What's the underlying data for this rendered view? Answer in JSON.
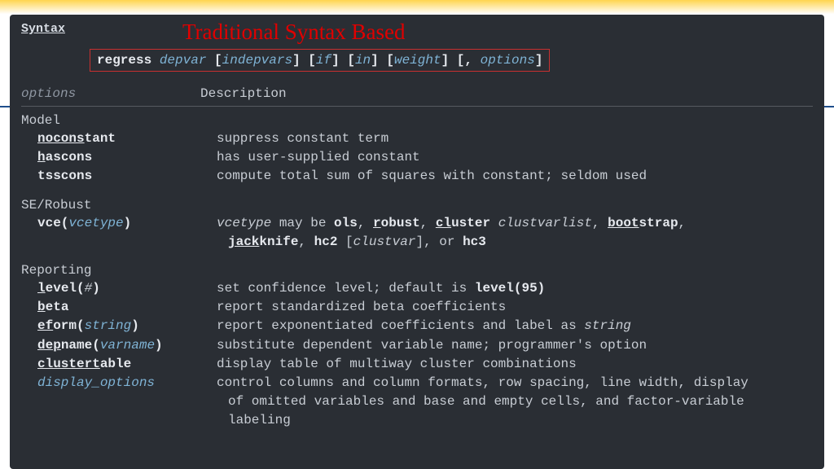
{
  "header": {
    "syntax_link": "Syntax",
    "red_title": "Traditional Syntax Based",
    "cmd": {
      "regress": "regress",
      "depvar": "depvar",
      "indepvars": "indepvars",
      "if": "if",
      "in": "in",
      "weight": "weight",
      "options": "options"
    },
    "options_hdr": "options",
    "description_hdr": "Description"
  },
  "sections": {
    "model": {
      "title": "Model",
      "noconstant": {
        "u": "nocons",
        "rest": "tant",
        "desc": "suppress constant term"
      },
      "hascons": {
        "u": "h",
        "rest": "ascons",
        "desc": "has user-supplied constant"
      },
      "tsscons": {
        "label": "tsscons",
        "desc": "compute total sum of squares with constant; seldom used"
      }
    },
    "se": {
      "title": "SE/Robust",
      "vce": {
        "label_pre": "vce(",
        "arg": "vcetype",
        "label_post": ")"
      },
      "vce_desc": {
        "vcetype": "vcetype",
        "p1": " may be ",
        "ols": "ols",
        "robust_u": "r",
        "robust_rest": "obust",
        "cluster_u": "cl",
        "cluster_rest": "uster",
        "clustvarlist": "clustvarlist",
        "boot_u": "boot",
        "boot_rest": "strap",
        "jack_u": "jack",
        "jack_rest": "knife",
        "hc2": "hc2",
        "clustvar": "clustvar",
        "or": ", or ",
        "hc3": "hc3"
      }
    },
    "reporting": {
      "title": "Reporting",
      "level": {
        "u": "l",
        "rest": "evel(",
        "arg": "#",
        "post": ")",
        "desc_pre": "set confidence level; default is ",
        "desc_bold": "level(95)"
      },
      "beta": {
        "u": "b",
        "rest": "eta",
        "desc": "report standardized beta coefficients"
      },
      "eform": {
        "u": "ef",
        "rest": "orm(",
        "arg": "string",
        "post": ")",
        "desc_pre": "report exponentiated coefficients and label as ",
        "desc_it": "string"
      },
      "depname": {
        "u": "dep",
        "rest": "name(",
        "arg": "varname",
        "post": ")",
        "desc": "substitute dependent variable name; programmer's option"
      },
      "clustert": {
        "u": "clustert",
        "rest": "able",
        "desc": "display table of multiway cluster combinations"
      },
      "display": {
        "label": "display_options",
        "l1": "control columns and column formats, row spacing, line width, display",
        "l2": "of omitted variables and base and empty cells, and factor-variable",
        "l3": "labeling"
      }
    }
  }
}
